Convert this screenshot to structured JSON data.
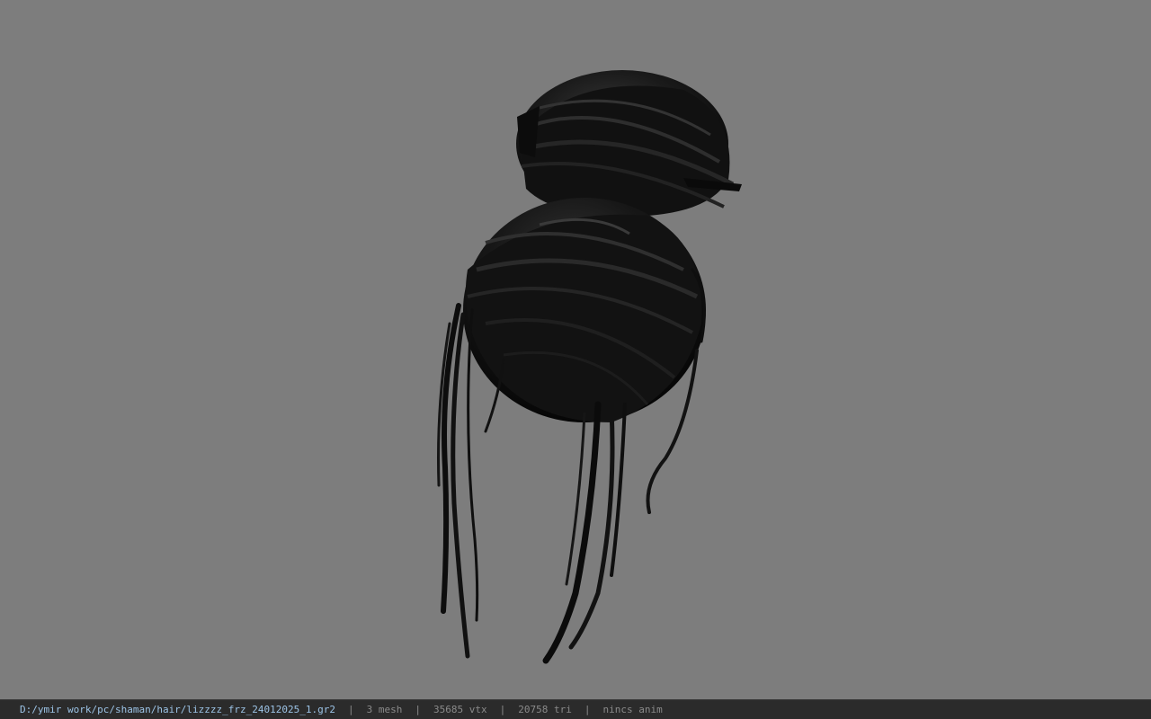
{
  "viewport": {
    "background": "#7d7d7d",
    "model_color": "#0d0d0d"
  },
  "statusbar": {
    "file_path": "D:/ymir work/pc/shaman/hair/lizzzz_frz_24012025_1.gr2",
    "separator": "|",
    "mesh_count": "3 mesh",
    "vertex_count": "35685 vtx",
    "triangle_count": "20758 tri",
    "animation": "nincs anim"
  }
}
